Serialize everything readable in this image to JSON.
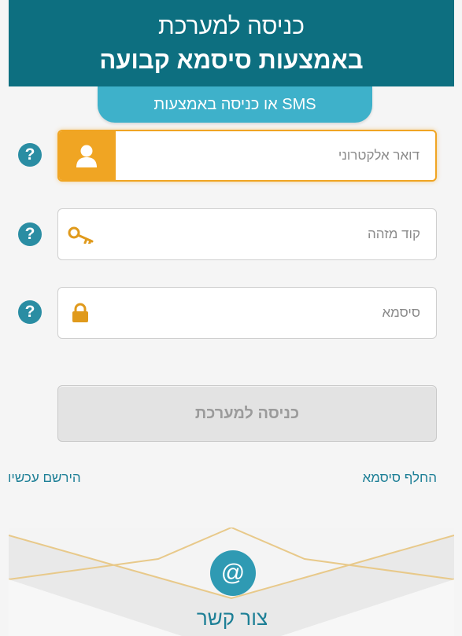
{
  "header": {
    "title_line1": "כניסה למערכת",
    "title_line2": "באמצעות סיסמא קבועה"
  },
  "sms_tab": {
    "label": "או כניסה באמצעות SMS"
  },
  "fields": {
    "email": {
      "placeholder": "דואר אלקטרוני",
      "value": "",
      "help": "?",
      "icon": "user-icon"
    },
    "id_code": {
      "placeholder": "קוד מזהה",
      "value": "",
      "help": "?",
      "icon": "key-icon"
    },
    "password": {
      "placeholder": "סיסמא",
      "value": "",
      "help": "?",
      "icon": "lock-icon"
    }
  },
  "login_button": {
    "label": "כניסה למערכת"
  },
  "links": {
    "register": "הירשם עכשיו",
    "change_password": "החלף סיסמא"
  },
  "contact": {
    "icon_glyph": "@",
    "label": "צור קשר"
  },
  "colors": {
    "header_bg": "#0d6f80",
    "tab_bg": "#3eb1ca",
    "accent_orange": "#f0a523",
    "link": "#1d7f96"
  }
}
